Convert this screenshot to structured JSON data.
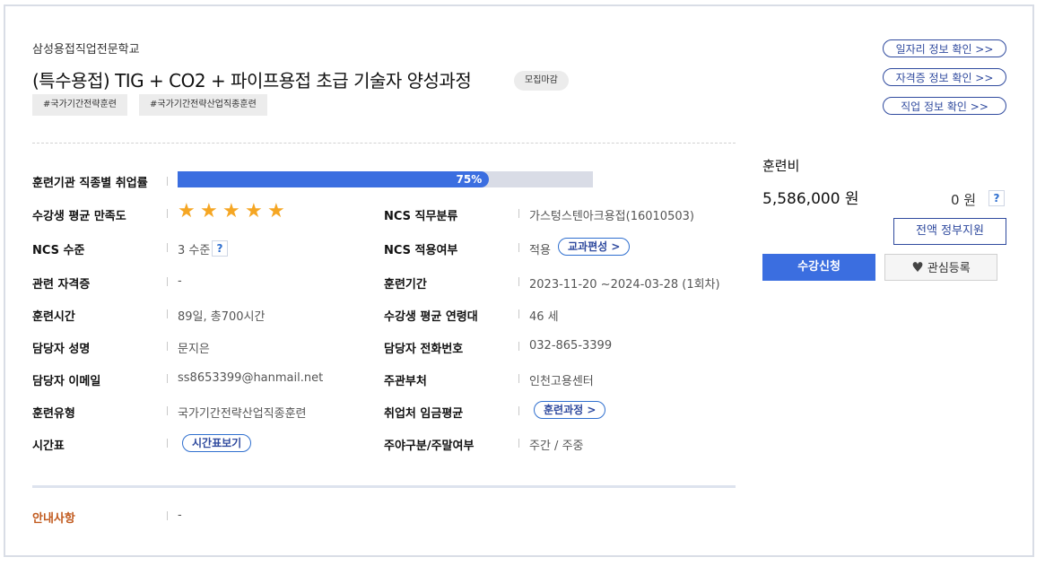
{
  "header": {
    "institution": "삼성용접직업전문학교",
    "title": "(특수용접) TIG + CO2 + 파이프용접 초급 기술자 양성과정",
    "status_badge": "모집마감",
    "tags": [
      "#국가기간전략훈련",
      "#국가기간전략산업직종훈련"
    ]
  },
  "links": {
    "job_info": "일자리 정보 확인 >>",
    "cert_info": "자격증 정보 확인 >>",
    "occupation_info": "직업 정보 확인 >>"
  },
  "employment_rate": {
    "label": "훈련기관 직종별 취업률",
    "value_text": "75%",
    "value": 75
  },
  "satisfaction": {
    "label": "수강생 평균 만족도",
    "stars": 5
  },
  "details": {
    "ncs_level_label": "NCS 수준",
    "ncs_level_value": "3 수준",
    "help_symbol": "?",
    "cert_label": "관련 자격증",
    "cert_value": "-",
    "hours_label": "훈련시간",
    "hours_value": "89일, 총700시간",
    "manager_name_label": "담당자 성명",
    "manager_name_value": "문지은",
    "manager_email_label": "담당자 이메일",
    "manager_email_value": "ss8653399@hanmail.net",
    "type_label": "훈련유형",
    "type_value": "국가기간전략산업직종훈련",
    "timetable_label": "시간표",
    "timetable_button": "시간표보기",
    "ncs_job_label": "NCS 직무분류",
    "ncs_job_value": "가스텅스텐아크용접(16010503)",
    "ncs_apply_label": "NCS 적용여부",
    "ncs_apply_value": "적용",
    "curriculum_button": "교과편성 >",
    "period_label": "훈련기간",
    "period_value": "2023-11-20 ~2024-03-28 (1회차)",
    "age_label": "수강생 평균 연령대",
    "age_value": "46 세",
    "phone_label": "담당자 전화번호",
    "phone_value": "032-865-3399",
    "dept_label": "주관부처",
    "dept_value": "인천고용센터",
    "wage_label": "취업처 임금평균",
    "wage_button": "훈련과정 >",
    "schedule_label": "주야구분/주말여부",
    "schedule_value": "주간 / 주중"
  },
  "notice": {
    "label": "안내사항",
    "value": "-"
  },
  "fee": {
    "label": "훈련비",
    "amount": "5,586,000 원",
    "self_pay": "0 원",
    "help_symbol": "?",
    "support_button": "전액 정부지원",
    "apply_button": "수강신청",
    "favorite_button": "관심등록"
  },
  "colors": {
    "accent": "#3b6ee0",
    "link": "#2f4a9e",
    "star": "#f5a623",
    "notice": "#c15a1e"
  }
}
